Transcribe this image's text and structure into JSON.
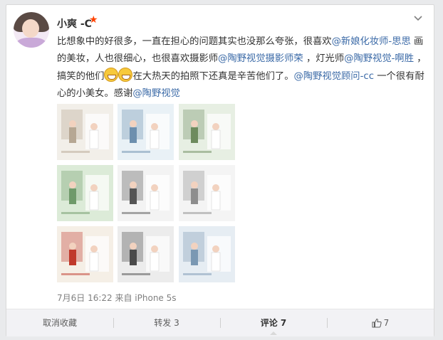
{
  "post": {
    "username": "小爽 -C",
    "vip_icon": "star-icon",
    "vip_color": "#ff4200",
    "text_parts": [
      {
        "t": "text",
        "v": "比想象中的好很多，一直在担心的问题其实也没那么夸张，很喜欢"
      },
      {
        "t": "at",
        "v": "@新娘化妆师-思思"
      },
      {
        "t": "text",
        "v": " 画的美妆，人也很细心，也很喜欢摄影师"
      },
      {
        "t": "at",
        "v": "@陶野视觉摄影师荣"
      },
      {
        "t": "text",
        "v": " ，灯光师"
      },
      {
        "t": "at",
        "v": "@陶野视觉-啊胜"
      },
      {
        "t": "text",
        "v": " ，搞笑的他们"
      },
      {
        "t": "emo",
        "v": "grin-emoji"
      },
      {
        "t": "emo",
        "v": "grin-emoji"
      },
      {
        "t": "text",
        "v": "在大热天的拍照下还真是辛苦他们了。"
      },
      {
        "t": "at",
        "v": "@陶野视觉顾问-cc"
      },
      {
        "t": "text",
        "v": " 一个很有耐心的小美女。感谢"
      },
      {
        "t": "at",
        "v": "@陶野视觉"
      }
    ],
    "photos": [
      {
        "name": "wedding-photo-1",
        "bg": "#f2efe9",
        "accent": "#b6a793"
      },
      {
        "name": "wedding-photo-2",
        "bg": "#e9f1f6",
        "accent": "#6d8fae"
      },
      {
        "name": "wedding-photo-3",
        "bg": "#e7efe3",
        "accent": "#6e8b5e"
      },
      {
        "name": "wedding-photo-4",
        "bg": "#dcebd8",
        "accent": "#6f9a6a"
      },
      {
        "name": "wedding-photo-5",
        "bg": "#f3f3f3",
        "accent": "#555555"
      },
      {
        "name": "wedding-photo-6",
        "bg": "#f4f4f4",
        "accent": "#8d8d8d"
      },
      {
        "name": "wedding-photo-7",
        "bg": "#f5efe6",
        "accent": "#c0392b"
      },
      {
        "name": "wedding-photo-8",
        "bg": "#ececec",
        "accent": "#4a4a4a"
      },
      {
        "name": "wedding-photo-9",
        "bg": "#e6edf3",
        "accent": "#7a98b3"
      }
    ],
    "time": "7月6日 16:22 来自 iPhone 5s"
  },
  "footer": {
    "uncollect": "取消收藏",
    "repost": "转发 3",
    "comment": "评论 7",
    "like_count": "7",
    "like_icon": "thumbs-up-icon"
  }
}
